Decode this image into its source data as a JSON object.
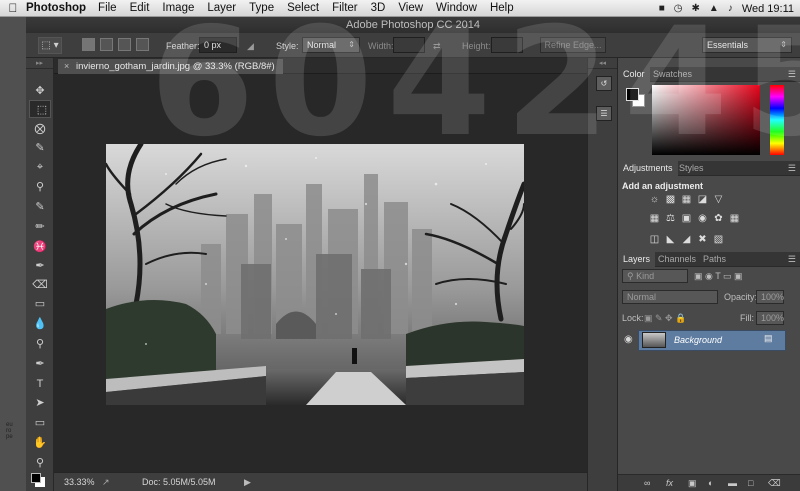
{
  "menubar": {
    "app": "Photoshop",
    "items": [
      "File",
      "Edit",
      "Image",
      "Layer",
      "Type",
      "Select",
      "Filter",
      "3D",
      "View",
      "Window",
      "Help"
    ],
    "clock": "Wed 19:11"
  },
  "window": {
    "title": "Adobe Photoshop CC 2014"
  },
  "options": {
    "feather_label": "Feather:",
    "feather_value": "0 px",
    "style_label": "Style:",
    "style_value": "Normal",
    "width_label": "Width:",
    "height_label": "Height:",
    "refine_edge": "Refine Edge...",
    "workspace": "Essentials"
  },
  "document": {
    "tab_title": "invierno_gotham_jardin.jpg @ 33.3% (RGB/8#)",
    "close_glyph": "×"
  },
  "status": {
    "zoom": "33.33%",
    "doc": "Doc: 5.05M/5.05M"
  },
  "color_panel": {
    "tabs": [
      "Color",
      "Swatches"
    ],
    "fg": "#000000",
    "bg": "#ffffff"
  },
  "adjustments_panel": {
    "tabs": [
      "Adjustments",
      "Styles"
    ],
    "heading": "Add an adjustment"
  },
  "layers_panel": {
    "tabs": [
      "Layers",
      "Channels",
      "Paths"
    ],
    "filter": "Kind",
    "blend": "Normal",
    "opacity_label": "Opacity:",
    "opacity": "100%",
    "lock_label": "Lock:",
    "fill_label": "Fill:",
    "fill": "100%",
    "layers": [
      {
        "name": "Background",
        "locked": true,
        "visible": true
      }
    ]
  },
  "watermark": {
    "text": "604245",
    "side": "europe"
  }
}
